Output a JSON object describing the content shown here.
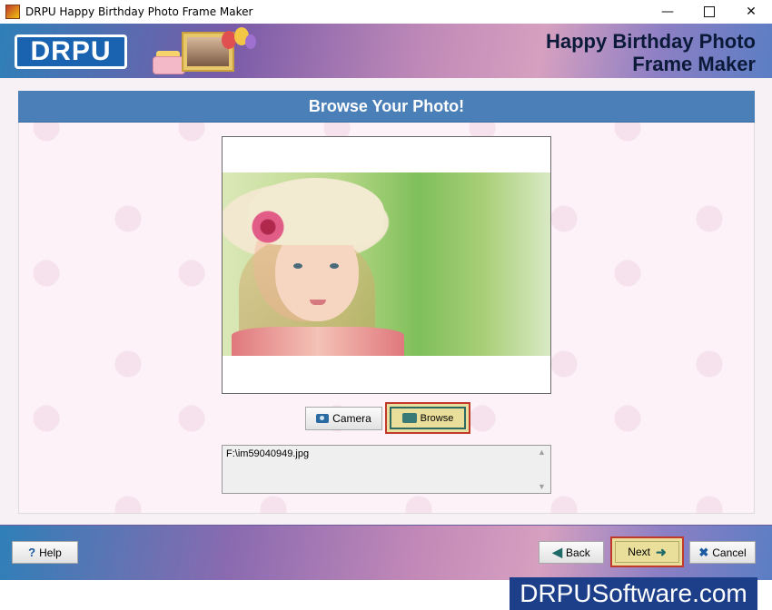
{
  "window": {
    "title": "DRPU Happy Birthday Photo Frame Maker",
    "min_symbol": "—",
    "close_symbol": "✕"
  },
  "header": {
    "logo": "DRPU",
    "title_line1": "Happy Birthday Photo",
    "title_line2": "Frame Maker"
  },
  "main": {
    "section_title": "Browse Your Photo!",
    "camera_label": "Camera",
    "browse_label": "Browse",
    "file_path": "F:\\im59040949.jpg",
    "scroll_up": "▲",
    "scroll_down": "▼"
  },
  "footer": {
    "help_label": "Help",
    "help_symbol": "?",
    "back_label": "Back",
    "next_label": "Next",
    "cancel_label": "Cancel",
    "brand": "DRPUSoftware.com"
  },
  "colors": {
    "header_blue": "#4a7fb8",
    "highlight_border": "#c0392b",
    "highlight_fill": "#eadf9a",
    "brand_bg": "#1d3f8a"
  },
  "icons": [
    "app-icon",
    "camera-icon",
    "folder-icon",
    "help-icon",
    "back-arrow-icon",
    "next-arrow-icon",
    "cancel-x-icon"
  ]
}
